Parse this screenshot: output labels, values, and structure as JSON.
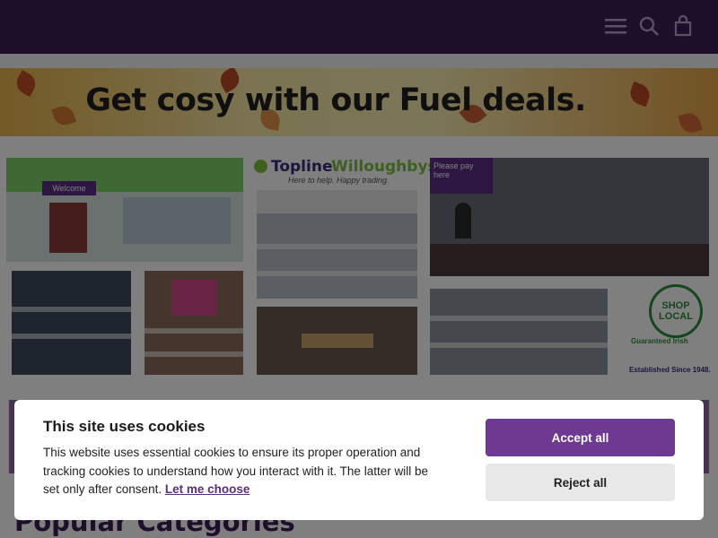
{
  "header": {
    "menu_icon": "hamburger-menu-icon",
    "search_icon": "search-icon",
    "cart_icon": "shopping-bag-icon",
    "background_color": "#3a1d52"
  },
  "banner": {
    "text": "Get cosy with our Fuel deals."
  },
  "gallery": {
    "store_logo": "Topline",
    "store_name": "Willoughbys",
    "tagline": "Here to help. Happy trading.",
    "sign_welcome": "Welcome",
    "sign_pay": "Please pay here",
    "shop_local_line1": "SHOP",
    "shop_local_line2": "LOCAL",
    "guaranteed_irish": "Guaranteed Irish",
    "established": "Established Since 1948."
  },
  "sections": {
    "popular_categories_title": "Popular Categories"
  },
  "cookie_banner": {
    "title": "This site uses cookies",
    "body": "This website uses essential cookies to ensure its proper operation and tracking cookies to understand how you interact with it. The latter will be set only after consent.",
    "link_label": "Let me choose",
    "accept_label": "Accept all",
    "reject_label": "Reject all",
    "accent_color": "#6e3a91"
  }
}
